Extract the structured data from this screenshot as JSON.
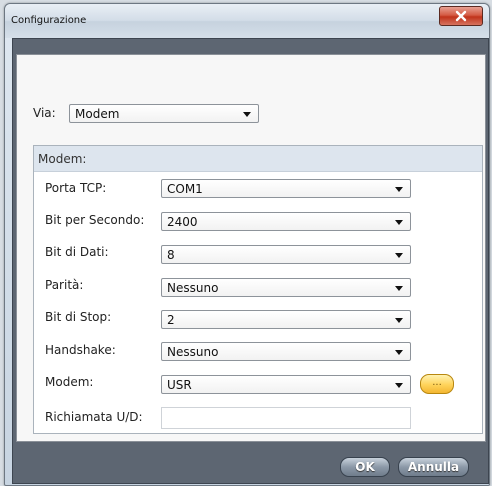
{
  "window": {
    "title": "Configurazione"
  },
  "via": {
    "label": "Via:",
    "value": "Modem"
  },
  "group": {
    "title": "Modem:"
  },
  "fields": {
    "porta_tcp": {
      "label": "Porta TCP:",
      "value": "COM1"
    },
    "bit_per_secondo": {
      "label": "Bit per Secondo:",
      "value": "2400"
    },
    "bit_di_dati": {
      "label": "Bit di Dati:",
      "value": "8"
    },
    "parita": {
      "label": "Parità:",
      "value": "Nessuno"
    },
    "bit_di_stop": {
      "label": "Bit di Stop:",
      "value": "2"
    },
    "handshake": {
      "label": "Handshake:",
      "value": "Nessuno"
    },
    "modem": {
      "label": "Modem:",
      "value": "USR",
      "more_label": "..."
    },
    "richiamata": {
      "label": "Richiamata U/D:",
      "value": ""
    }
  },
  "buttons": {
    "ok": "OK",
    "cancel": "Annulla"
  },
  "icons": {
    "close": "close-icon",
    "dropdown": "chevron-down-icon"
  },
  "colors": {
    "close": "#c7361d",
    "more_button": "#ffd35a",
    "frame": "#5d6672"
  }
}
